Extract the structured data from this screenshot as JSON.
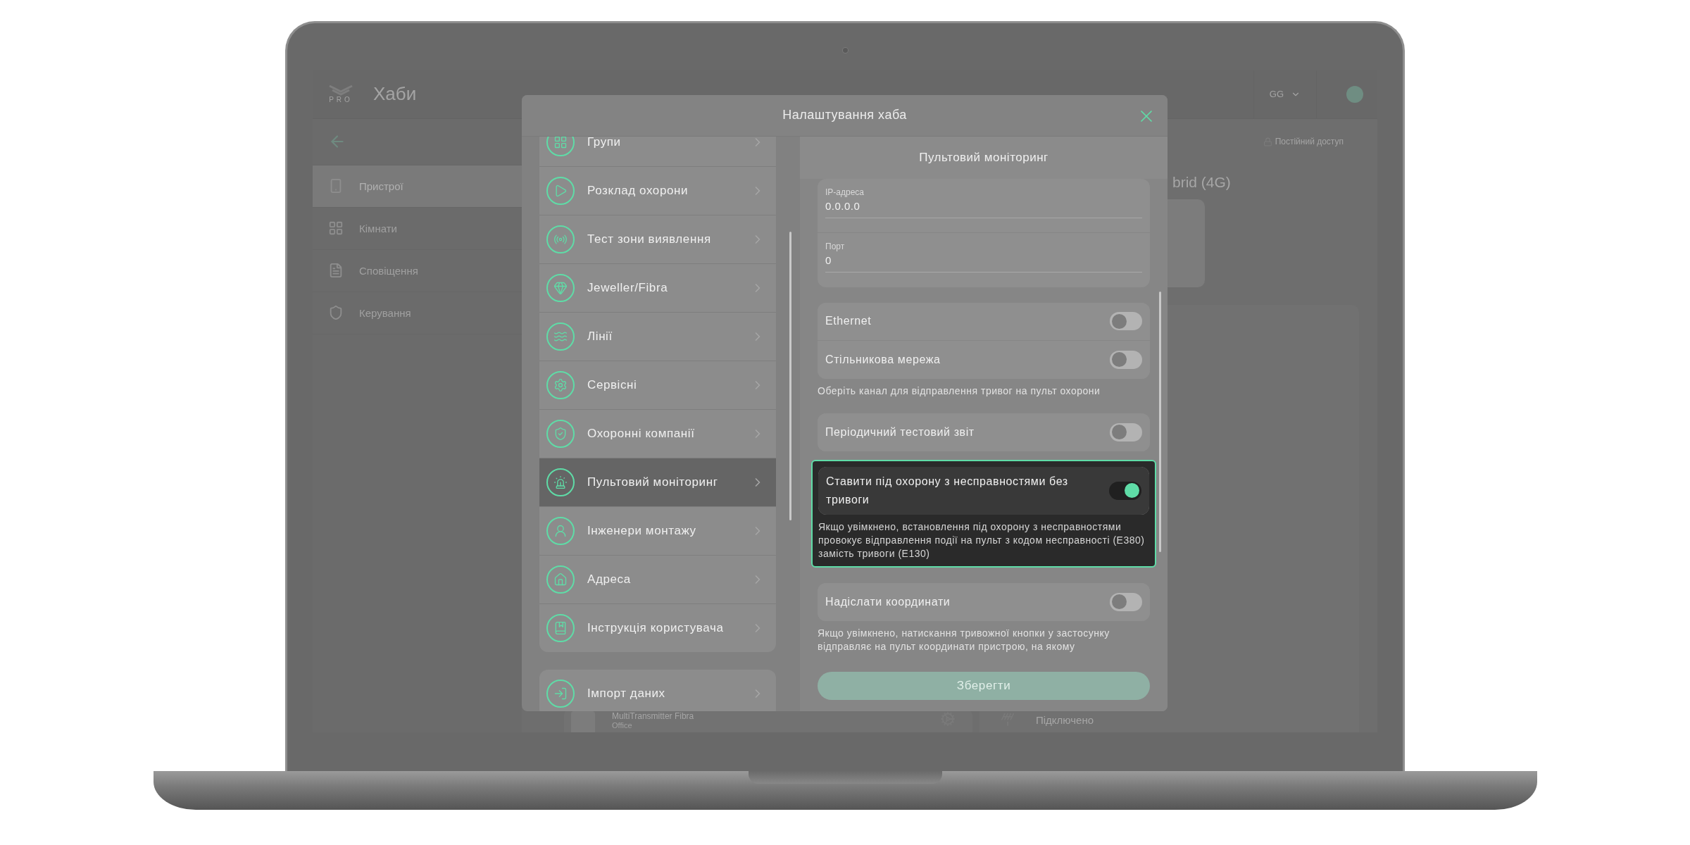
{
  "background_app": {
    "logo_text": "PRO",
    "title": "Хаби",
    "account": "GG",
    "sidebar_items": [
      {
        "label": "Пристрої",
        "selected": true
      },
      {
        "label": "Кімнати",
        "selected": false
      },
      {
        "label": "Сповіщення",
        "selected": false
      },
      {
        "label": "Керування",
        "selected": false
      }
    ],
    "access_link": "Постійний доступ",
    "hub_name": "brid (4G)",
    "device": {
      "name": "MultiTransmitter  Fibra",
      "room": "Office"
    },
    "status": "Підключено"
  },
  "modal": {
    "title": "Налаштування хаба",
    "menu": [
      {
        "label": "Групи",
        "selected": false
      },
      {
        "label": "Розклад охорони",
        "selected": false
      },
      {
        "label": "Тест зони виявлення",
        "selected": false
      },
      {
        "label": "Jeweller/Fibra",
        "selected": false
      },
      {
        "label": "Лінії",
        "selected": false
      },
      {
        "label": "Сервісні",
        "selected": false
      },
      {
        "label": "Охоронні компанії",
        "selected": false
      },
      {
        "label": "Пультовий моніторинг",
        "selected": true
      },
      {
        "label": "Інженери монтажу",
        "selected": false
      },
      {
        "label": "Адреса",
        "selected": false
      },
      {
        "label": "Інструкція користувача",
        "selected": false
      }
    ],
    "extra_menu": [
      {
        "label": "Імпорт даних",
        "selected": false
      }
    ],
    "panel": {
      "title": "Пультовий моніторинг",
      "fields": [
        {
          "label": "IP-адреса",
          "value": "0.0.0.0"
        },
        {
          "label": "Порт",
          "value": "0"
        }
      ],
      "sections": [
        {
          "highlighted": false,
          "toggles": [
            {
              "label": "Ethernet",
              "on": false
            },
            {
              "label": "Стільникова мережа",
              "on": false
            }
          ],
          "hint": "Оберіть канал для відправлення тривог на пульт охорони"
        },
        {
          "highlighted": false,
          "toggles": [
            {
              "label": "Періодичний тестовий звіт",
              "on": false
            }
          ]
        },
        {
          "highlighted": true,
          "toggles": [
            {
              "label": "Ставити під охорону з несправностями без тривоги",
              "on": true
            }
          ],
          "hint": "Якщо увімкнено, встановлення під охорону з несправностями провокує відправлення події на пульт з кодом несправності (E380) замість тривоги (E130)"
        },
        {
          "highlighted": false,
          "toggles": [
            {
              "label": "Надіслати координати",
              "on": false
            }
          ],
          "hint": "Якщо увімкнено, натискання тривожної кнопки у застосунку відправляє на пульт координати пристрою, на якому"
        }
      ],
      "save_button": "Зберегти"
    }
  }
}
